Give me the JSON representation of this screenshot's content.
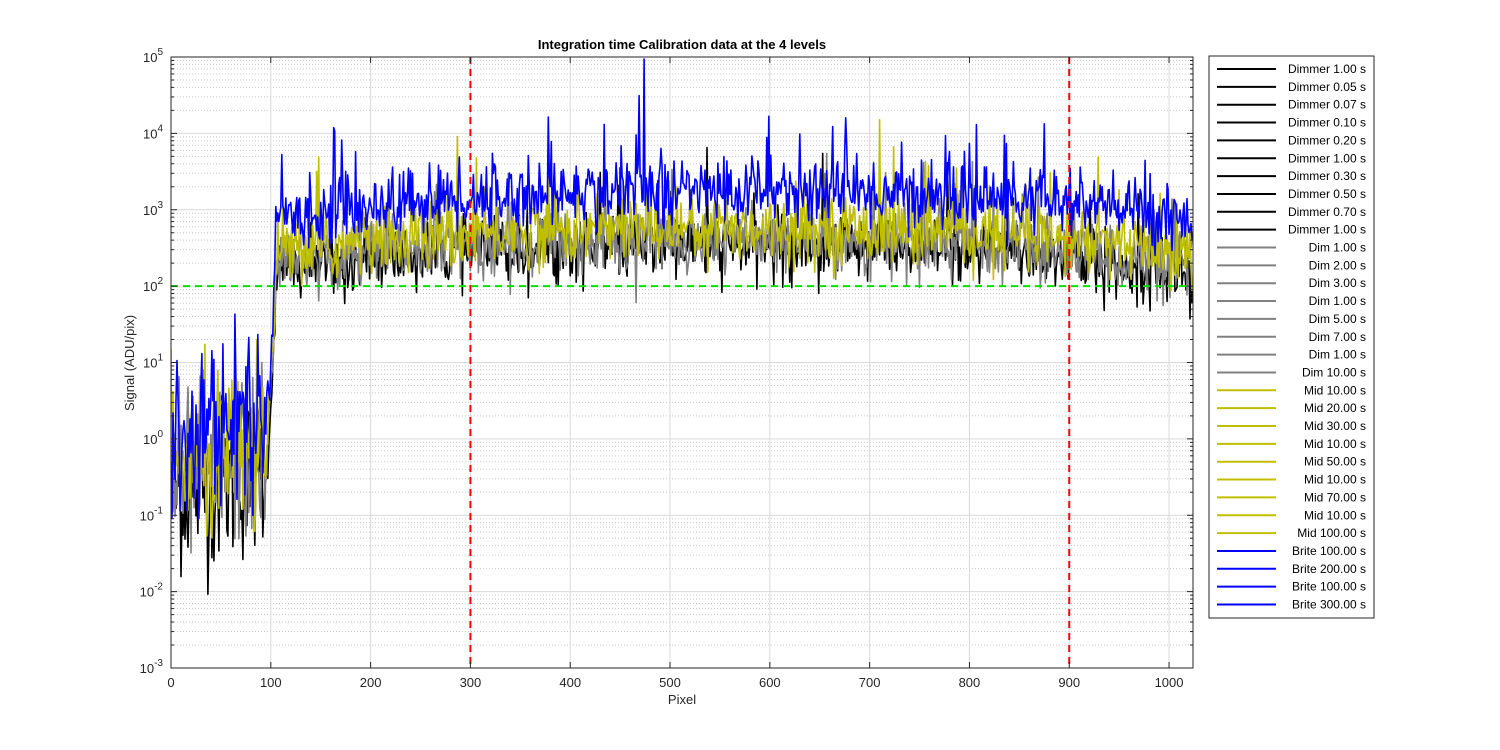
{
  "chart_data": {
    "type": "line",
    "title": "Integration time Calibration data at the 4 levels",
    "xlabel": "Pixel",
    "ylabel": "Signal (ADU/pix)",
    "xlim": [
      0,
      1024
    ],
    "ylim": [
      0.001,
      100000
    ],
    "yscale": "log",
    "grid": true,
    "minor_grid": true,
    "legend_position": "outside-right",
    "x_ticks": [
      "0",
      "100",
      "200",
      "300",
      "400",
      "500",
      "600",
      "700",
      "800",
      "900",
      "1000"
    ],
    "y_ticks": [
      {
        "base": "10",
        "exp": "-3"
      },
      {
        "base": "10",
        "exp": "-2"
      },
      {
        "base": "10",
        "exp": "-1"
      },
      {
        "base": "10",
        "exp": "0"
      },
      {
        "base": "10",
        "exp": "1"
      },
      {
        "base": "10",
        "exp": "2"
      },
      {
        "base": "10",
        "exp": "3"
      },
      {
        "base": "10",
        "exp": "4"
      },
      {
        "base": "10",
        "exp": "5"
      }
    ],
    "reference_lines": [
      {
        "orientation": "vertical",
        "x": 300,
        "color": "#ff0000",
        "style": "dashed"
      },
      {
        "orientation": "vertical",
        "x": 900,
        "color": "#ff0000",
        "style": "dashed"
      },
      {
        "orientation": "horizontal",
        "y": 100,
        "color": "#00e000",
        "style": "dashed"
      }
    ],
    "series_groups": [
      {
        "level": "Dimmer",
        "color": "#000000",
        "baseline": 350,
        "low_floor": 0.05
      },
      {
        "level": "Dim",
        "color": "#808080",
        "baseline": 420,
        "low_floor": 0.08
      },
      {
        "level": "Mid",
        "color": "#bfbf00",
        "baseline": 600,
        "low_floor": 0.1
      },
      {
        "level": "Brite",
        "color": "#0000ff",
        "baseline": 1800,
        "low_floor": 0.3
      }
    ],
    "legend": [
      {
        "label": "Dimmer 1.00 s",
        "color": "#000000"
      },
      {
        "label": "Dimmer 0.05 s",
        "color": "#000000"
      },
      {
        "label": "Dimmer 0.07 s",
        "color": "#000000"
      },
      {
        "label": "Dimmer 0.10 s",
        "color": "#000000"
      },
      {
        "label": "Dimmer 0.20 s",
        "color": "#000000"
      },
      {
        "label": "Dimmer 1.00 s",
        "color": "#000000"
      },
      {
        "label": "Dimmer 0.30 s",
        "color": "#000000"
      },
      {
        "label": "Dimmer 0.50 s",
        "color": "#000000"
      },
      {
        "label": "Dimmer 0.70 s",
        "color": "#000000"
      },
      {
        "label": "Dimmer 1.00 s",
        "color": "#000000"
      },
      {
        "label": "Dim 1.00 s",
        "color": "#808080"
      },
      {
        "label": "Dim 2.00 s",
        "color": "#808080"
      },
      {
        "label": "Dim 3.00 s",
        "color": "#808080"
      },
      {
        "label": "Dim 1.00 s",
        "color": "#808080"
      },
      {
        "label": "Dim 5.00 s",
        "color": "#808080"
      },
      {
        "label": "Dim 7.00 s",
        "color": "#808080"
      },
      {
        "label": "Dim 1.00 s",
        "color": "#808080"
      },
      {
        "label": "Dim 10.00 s",
        "color": "#808080"
      },
      {
        "label": "Mid 10.00 s",
        "color": "#bfbf00"
      },
      {
        "label": "Mid 20.00 s",
        "color": "#bfbf00"
      },
      {
        "label": "Mid 30.00 s",
        "color": "#bfbf00"
      },
      {
        "label": "Mid 10.00 s",
        "color": "#bfbf00"
      },
      {
        "label": "Mid 50.00 s",
        "color": "#bfbf00"
      },
      {
        "label": "Mid 10.00 s",
        "color": "#bfbf00"
      },
      {
        "label": "Mid 70.00 s",
        "color": "#bfbf00"
      },
      {
        "label": "Mid 10.00 s",
        "color": "#bfbf00"
      },
      {
        "label": "Mid 100.00 s",
        "color": "#bfbf00"
      },
      {
        "label": "Brite 100.00 s",
        "color": "#0000ff"
      },
      {
        "label": "Brite 200.00 s",
        "color": "#0000ff"
      },
      {
        "label": "Brite 100.00 s",
        "color": "#0000ff"
      },
      {
        "label": "Brite 300.00 s",
        "color": "#0000ff"
      }
    ]
  }
}
